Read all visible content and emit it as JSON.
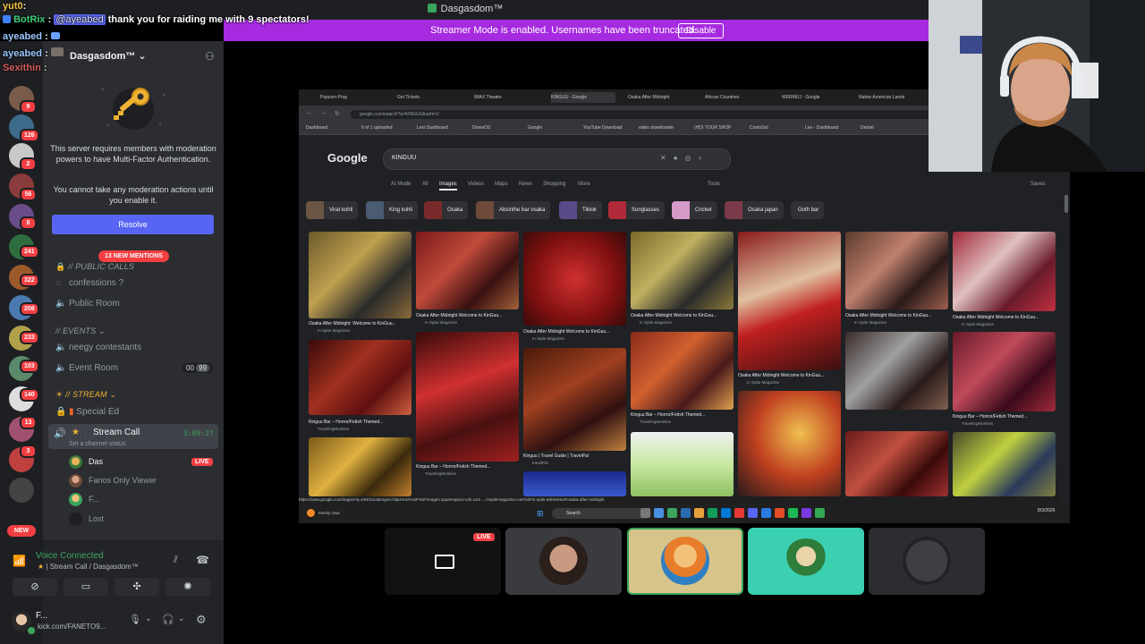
{
  "window": {
    "title": "Dasgasdom™"
  },
  "banner": {
    "text": "Streamer Mode is enabled. Usernames have been truncated.",
    "disable_label": "Disable"
  },
  "chat": [
    {
      "user": "yut0",
      "sep": ":",
      "text": "",
      "color": "#f2c744"
    },
    {
      "user": "BotRix",
      "sep": ":",
      "mention": "@ayeabed",
      "text": "thank you for raiding me with 9 spectators!",
      "color": "#3ed07c"
    },
    {
      "user": "ayeabed",
      "sep": ":",
      "text": "",
      "color": "#9cc8ff"
    },
    {
      "user": "ayeabed",
      "sep": ":",
      "text": "",
      "color": "#9cc8ff"
    },
    {
      "user": "Sexithin",
      "sep": ":",
      "text": "",
      "color": "#ff6a6a"
    }
  ],
  "guild_badges": [
    "9",
    "126",
    "2",
    "56",
    "8",
    "241",
    "322",
    "208",
    "233",
    "103",
    "140",
    "13",
    "3"
  ],
  "new_label": "NEW",
  "server": {
    "name": "Dasgasdom™"
  },
  "mfa": {
    "message": "This server requires members with moderation powers to have Multi-Factor Authentication.",
    "sub": "You cannot take any moderation actions until you enable it.",
    "resolve_label": "Resolve"
  },
  "mentions_label": "13 NEW MENTIONS",
  "categories": {
    "public_calls": "// PUBLIC CALLS",
    "events": "// Events",
    "stream": "// STREAM"
  },
  "channels": {
    "confessions": "confessions ?",
    "public_room": "Public Room",
    "neegy": "neegy contestants",
    "event_room": "Event Room",
    "event_room_count_a": "00",
    "event_room_count_b": "99",
    "special_ed": "Special Ed",
    "stream_call": "Stream Call",
    "stream_call_time": "3:09:27",
    "stream_call_status": "Set a channel status"
  },
  "voice_users": [
    {
      "name": "Das",
      "live": "LIVE"
    },
    {
      "name": "Fanos Only Viewer"
    },
    {
      "name": "F..."
    },
    {
      "name": "Lost"
    }
  ],
  "voice": {
    "connected": "Voice Connected",
    "location": "Stream Call / Dasgasdom™"
  },
  "user": {
    "name": "F...",
    "status": "kick.com/FANETO9..."
  },
  "browser": {
    "tabs": [
      "Popcorn Pray",
      "Get Tickets",
      "IMAX Theatre",
      "KINGUU - Google",
      "Osaka After Midnight",
      "African Countries",
      "WERMUJ - Google",
      "Native American Lands"
    ],
    "url": "google.com/search?q=KINGUU&udm=2",
    "bookmarks": [
      "Dashboard",
      "6 of 1 uploaded",
      "Lexi Dashboard",
      "DomsOS",
      "Google",
      "YouTube Download",
      "video downloader",
      "(HD) TOUR SHOP",
      "ContoSol",
      "Leo - Dashboard",
      "Detroit"
    ],
    "query": "KINGUU",
    "nav_tabs": [
      "AI Mode",
      "All",
      "Images",
      "Videos",
      "Maps",
      "News",
      "Shopping",
      "More"
    ],
    "tools": "Tools",
    "saves": "Saves",
    "chips": [
      "Virat kohli",
      "King kohli",
      "Osaka",
      "Absinthe bar osaka",
      "Tiktok",
      "Sunglasses",
      "Cricket",
      "Osaka japan",
      "Goth bar"
    ],
    "captions": [
      "Osaka After Midnight: Welcome to KinGuu...",
      "Osaka After Midnight Welcome to KinGuu...",
      "Osaka After Midnight Welcome to KinGuu...",
      "Osaka After Midnight Welcome to KinGuu...",
      "Osaka After Midnight Welcome to KinGuu...",
      "Osaka After Midnight Welcome to KinGuu...",
      "Osaka After Midnight Welcome to KinGuu...",
      "Kinguu Bar – Horror/Fetish Themed...",
      "Kinguu Bar – Horror/Fetish Themed...",
      "Kinguu Bar – Horror/Fetish Themed...",
      "Kinguu Bar – Horror/Fetish Themed...",
      "Kinguu | Travel Guide | TravelPal"
    ],
    "sources": [
      "In Spite Magazine",
      "In Spite Magazine",
      "In Spite Magazine",
      "In Spite Magazine",
      "In Spite Magazine",
      "In Spite Magazine",
      "In Spite Magazine",
      "TravelingMonkies",
      "TravelingMonkies",
      "TravelingMonkies",
      "TravelingMonkies",
      "travelPal"
    ],
    "status_url": "https://www.google.com/imgres?q=KINGUU&imgurl=https%3A%2F%2Fimages.squarespace-cdn.com ... inspitemagazine.com%2Fin-spite-articles%2Fosaka-after-midnight",
    "taskbar_search": "Search",
    "clock": "8/3/2026",
    "weather": "Mostly clear"
  },
  "tiles": {
    "live_label": "LIVE"
  },
  "colors": {
    "accent": "#5865f2",
    "banner": "#a62be0",
    "danger": "#f23f43",
    "online": "#3ba55d"
  }
}
